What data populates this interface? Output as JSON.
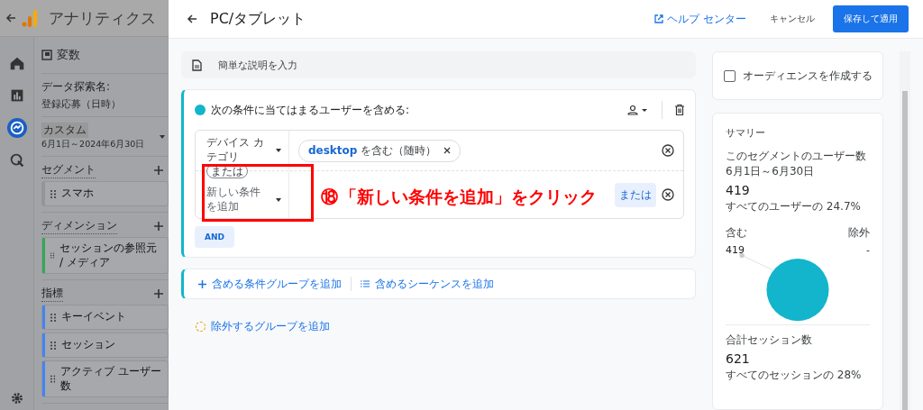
{
  "app_bar": {
    "title": "アナリティクス"
  },
  "nav_rail": [
    {
      "selected": false
    },
    {
      "selected": false
    },
    {
      "selected": true
    },
    {
      "selected": false
    }
  ],
  "variables_panel": {
    "title": "変数",
    "exploration_label": "データ探索名:",
    "exploration_name": "登録応募（日時）",
    "date_range": {
      "label": "カスタム",
      "value": "6月1日～2024年6月30日"
    },
    "sections": [
      {
        "title": "セグメント",
        "items": [
          {
            "label": "スマホ"
          }
        ]
      },
      {
        "title": "ディメンション",
        "items": [
          {
            "label": "セッションの参照元 / メディア",
            "color": "#34a853"
          }
        ]
      },
      {
        "title": "指標",
        "items": [
          {
            "label": "キーイベント",
            "color": "#4285f4"
          },
          {
            "label": "セッション",
            "color": "#4285f4"
          },
          {
            "label": "アクティブ ユーザー数",
            "color": "#4285f4"
          }
        ]
      }
    ]
  },
  "dialog": {
    "title": "PC/タブレット",
    "help_link": "ヘルプ センター",
    "cancel_button": "キャンセル",
    "save_button": "保存して適用",
    "description_placeholder": "簡単な説明を入力",
    "group": {
      "heading": "次の条件に当てはまるユーザーを含める:",
      "conditions": [
        {
          "dimension": "デバイス カテゴリ",
          "chip": "**desktop** を含む（随時）"
        },
        {
          "or_label": "または",
          "dimension_placeholder": "新しい条件を追加",
          "or_button": "または"
        }
      ],
      "and_button": "AND"
    },
    "add_group_button": "含める条件グループを追加",
    "add_sequence_button": "含めるシーケンスを追加",
    "exclude_button": "除外するグループを追加"
  },
  "audience": {
    "label": "オーディエンスを作成する",
    "checked": false
  },
  "summary": {
    "title": "サマリー",
    "users_label": "このセグメントのユーザー数",
    "users_dates": "6月1日～6月30日",
    "users_value": "419",
    "users_share": "すべてのユーザーの 24.7%",
    "include_label": "含む",
    "include_value": "419",
    "exclude_label": "除外",
    "exclude_value": "-",
    "sessions_label": "合計セッション数",
    "sessions_value": "621",
    "sessions_share": "すべてのセッションの 28%"
  },
  "annotation": {
    "number": "⑱",
    "text": "「新しい条件を追加」をクリック"
  }
}
